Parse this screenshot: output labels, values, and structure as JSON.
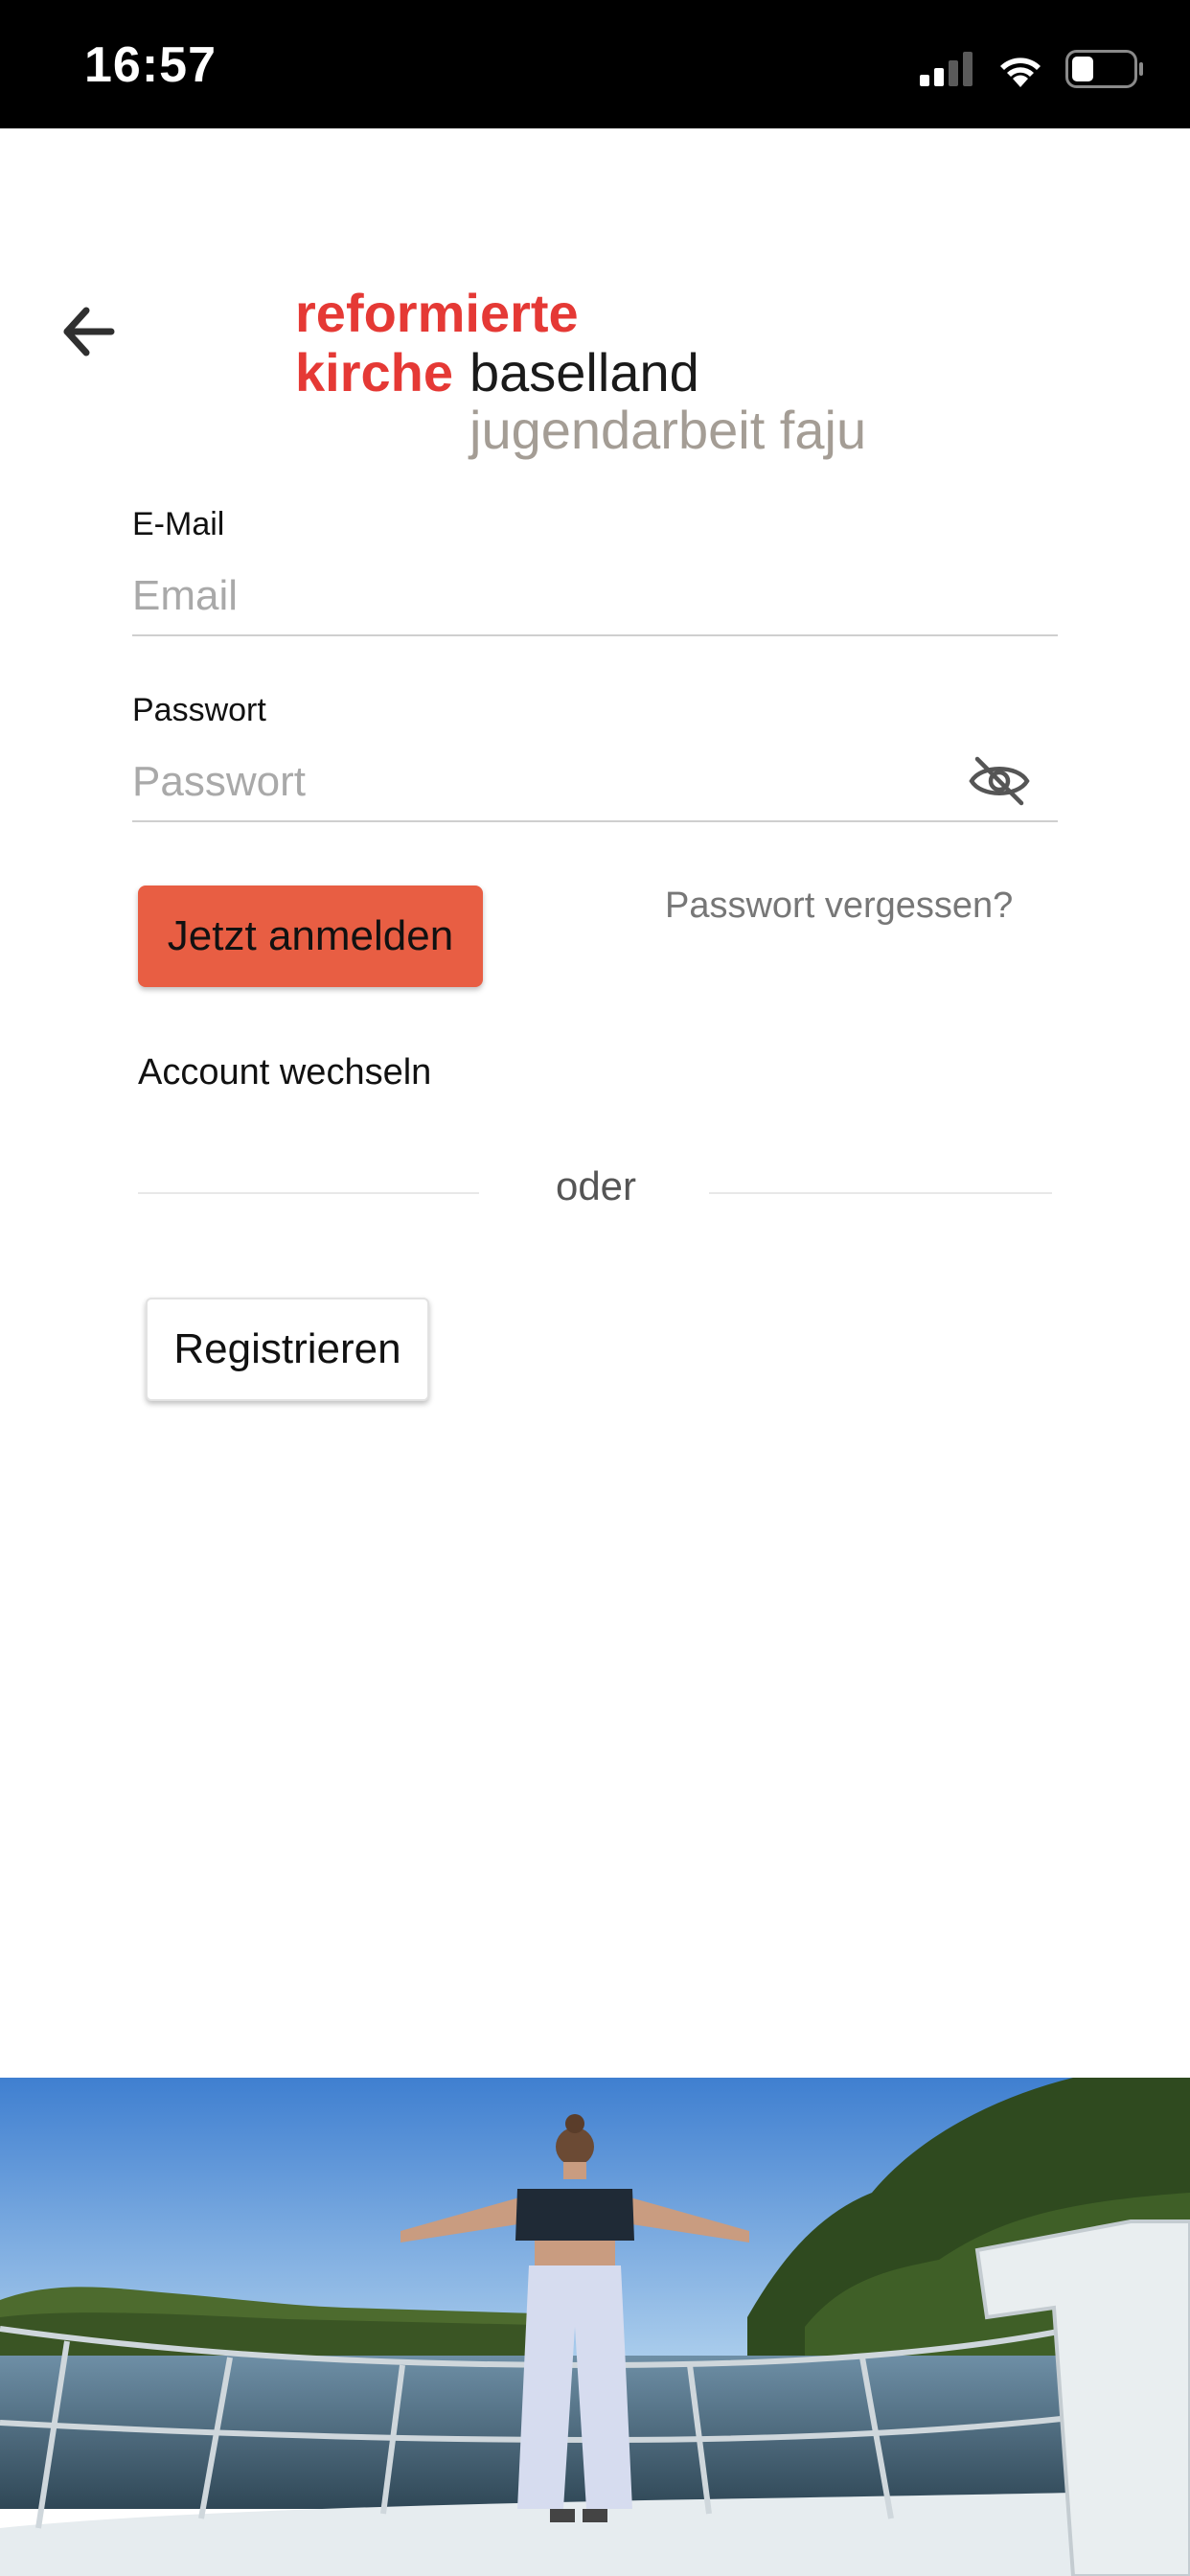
{
  "status_bar": {
    "time": "16:57",
    "icons": [
      "signal-icon",
      "wifi-icon",
      "battery-icon"
    ],
    "battery_level": 0.35
  },
  "logo": {
    "line1": "reformierte",
    "line2_red": "kirche",
    "line2_dark": "baselland",
    "line3": "jugendarbeit faju",
    "red_color": "#e53935",
    "gray_color": "#a49d95"
  },
  "form": {
    "email": {
      "label": "E-Mail",
      "placeholder": "Email",
      "value": ""
    },
    "password": {
      "label": "Passwort",
      "placeholder": "Passwort",
      "value": "",
      "toggle_icon": "eye-off-icon"
    },
    "login_label": "Jetzt anmelden",
    "forgot_label": "Passwort vergessen?",
    "switch_account_label": "Account wechseln",
    "divider_label": "oder",
    "register_label": "Registrieren",
    "accent_color": "#e85e43"
  },
  "navigation": {
    "back_icon": "arrow-left-icon"
  },
  "hero_image": {
    "subject": "person-on-boat-bow-photo"
  }
}
